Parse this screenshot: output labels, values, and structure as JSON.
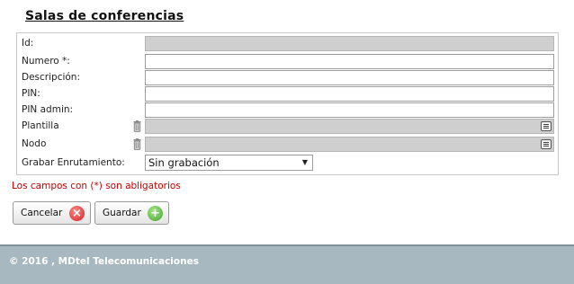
{
  "page": {
    "title": "Salas de conferencias"
  },
  "form": {
    "fields": [
      {
        "label": "Id:",
        "value": ""
      },
      {
        "label": "Numero *:",
        "value": ""
      },
      {
        "label": "Descripción:",
        "value": ""
      },
      {
        "label": "PIN:",
        "value": ""
      },
      {
        "label": "PIN admin:",
        "value": ""
      },
      {
        "label": "Plantilla",
        "value": ""
      },
      {
        "label": "Nodo",
        "value": ""
      },
      {
        "label": "Grabar Enrutamiento:",
        "value": "Sin grabación"
      }
    ],
    "required_note": "Los campos con (*) son abligatorios"
  },
  "buttons": {
    "cancel_label": "Cancelar",
    "save_label": "Guardar"
  },
  "footer": {
    "text": "© 2016 , MDtel Telecomunicaciones"
  },
  "icons": {
    "trash": "trash-icon",
    "list": "list-icon",
    "cancel": "cancel-x-icon",
    "save": "add-plus-icon",
    "dropdown": "dropdown-arrow-icon"
  }
}
